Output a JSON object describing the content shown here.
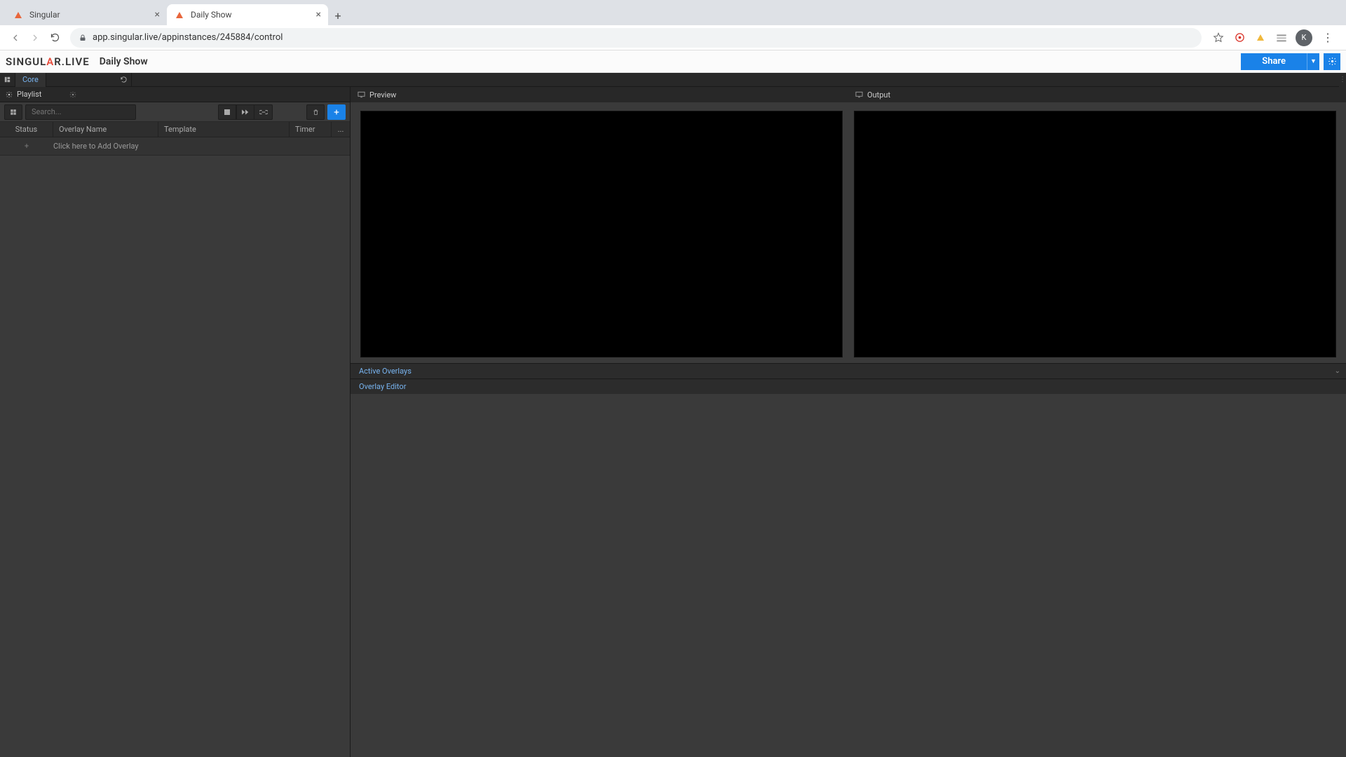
{
  "browser": {
    "tabs": [
      {
        "title": "Singular",
        "active": false
      },
      {
        "title": "Daily Show",
        "active": true
      }
    ],
    "url": "app.singular.live/appinstances/245884/control"
  },
  "header": {
    "logo": "SINGULAR.LIVE",
    "app_title": "Daily Show",
    "share_label": "Share"
  },
  "toolbar": {
    "core_label": "Core"
  },
  "playlist": {
    "title": "Playlist",
    "search_placeholder": "Search...",
    "columns": {
      "status": "Status",
      "name": "Overlay Name",
      "template": "Template",
      "timer": "Timer",
      "more": "..."
    },
    "add_row_label": "Click here to Add Overlay"
  },
  "panels": {
    "preview_label": "Preview",
    "output_label": "Output",
    "active_overlays_label": "Active Overlays",
    "overlay_editor_label": "Overlay Editor"
  }
}
